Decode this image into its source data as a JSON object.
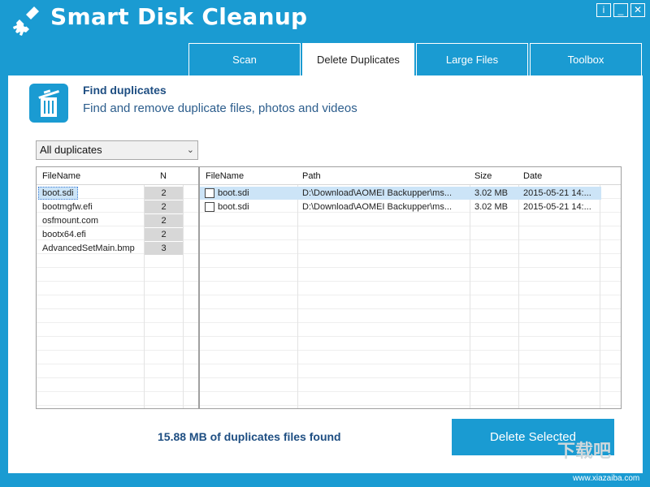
{
  "app": {
    "title": "Smart Disk Cleanup"
  },
  "window_buttons": {
    "info": "i",
    "minimize": "_",
    "close": "✕"
  },
  "tabs": [
    {
      "label": "Scan",
      "active": false
    },
    {
      "label": "Delete Duplicates",
      "active": true
    },
    {
      "label": "Large Files",
      "active": false
    },
    {
      "label": "Toolbox",
      "active": false
    }
  ],
  "header": {
    "title": "Find duplicates",
    "subtitle": "Find and remove duplicate files, photos and videos"
  },
  "filter": {
    "selected": "All duplicates"
  },
  "left_table": {
    "columns": [
      "FileName",
      "N"
    ],
    "rows": [
      {
        "name": "boot.sdi",
        "count": "2",
        "selected": true
      },
      {
        "name": "bootmgfw.efi",
        "count": "2"
      },
      {
        "name": "osfmount.com",
        "count": "2"
      },
      {
        "name": "bootx64.efi",
        "count": "2"
      },
      {
        "name": "AdvancedSetMain.bmp",
        "count": "3"
      }
    ]
  },
  "right_table": {
    "columns": [
      "FileName",
      "Path",
      "Size",
      "Date"
    ],
    "rows": [
      {
        "name": "boot.sdi",
        "path": "D:\\Download\\AOMEI Backupper\\ms...",
        "size": "3.02 MB",
        "date": "2015-05-21 14:...",
        "selected": true,
        "checked": false
      },
      {
        "name": "boot.sdi",
        "path": "D:\\Download\\AOMEI Backupper\\ms...",
        "size": "3.02 MB",
        "date": "2015-05-21 14:...",
        "selected": false,
        "checked": false
      }
    ]
  },
  "summary": "15.88 MB of duplicates files found",
  "actions": {
    "delete_selected": "Delete Selected"
  },
  "watermark": {
    "text": "下载吧",
    "site": "www.xiazaiba.com"
  },
  "colors": {
    "accent": "#1a9bd2",
    "title_text": "#1e4e82",
    "selection": "#cce4f7"
  }
}
